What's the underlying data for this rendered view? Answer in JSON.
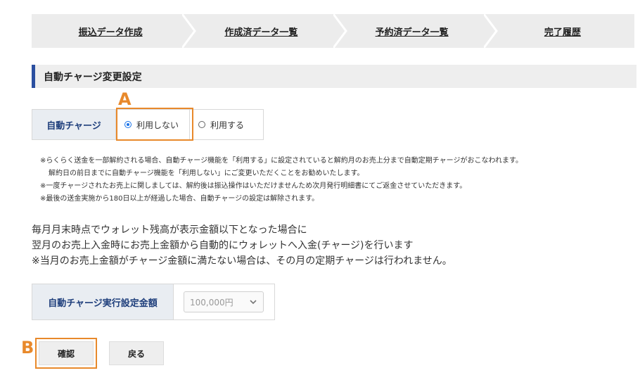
{
  "steps": [
    "振込データ作成",
    "作成済データ一覧",
    "予約済データ一覧",
    "完了履歴"
  ],
  "section_title": "自動チャージ変更設定",
  "auto_charge": {
    "label": "自動チャージ",
    "options": [
      {
        "label": "利用しない",
        "checked": true
      },
      {
        "label": "利用する",
        "checked": false
      }
    ]
  },
  "annotations": {
    "a": "A",
    "b": "B",
    "color": "#e8892b"
  },
  "notes": [
    "※らくらく送金を一部解約される場合、自動チャージ機能を「利用する」に設定されていると解約月のお売上分まで自動定期チャージがおこなわれます。",
    "解約日の前日までに自動チャージ機能を「利用しない」にご変更いただくことをお勧めいたします。",
    "※一度チャージされたお売上に関しましては、解約後は振込操作はいただけませんため次月発行明細書にてご返金させていただきます。",
    "※最後の送金実施から180日以上が経過した場合、自動チャージの設定は解除されます。"
  ],
  "description": [
    "毎月月末時点でウォレット残高が表示金額以下となった場合に",
    "翌月のお売上入金時にお売上金額から自動的にウォレットへ入金(チャージ)を行います",
    "※当月のお売上金額がチャージ金額に満たない場合は、その月の定期チャージは行われません。"
  ],
  "amount": {
    "label": "自動チャージ実行設定金額",
    "value": "100,000円"
  },
  "buttons": {
    "confirm": "確認",
    "back": "戻る"
  },
  "colors": {
    "accent": "#2b4fa0",
    "label_text": "#1f3f7c",
    "label_bg": "#e9edf2"
  }
}
